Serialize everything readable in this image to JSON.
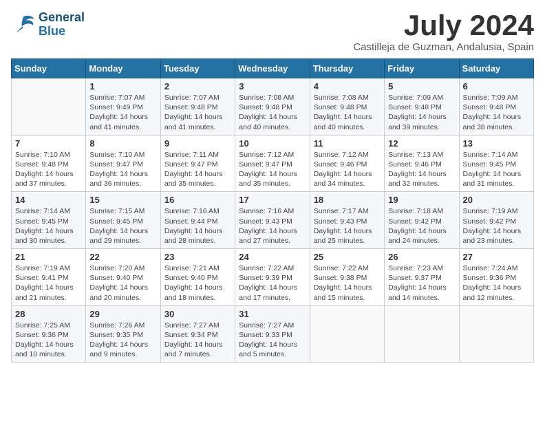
{
  "header": {
    "logo_line1": "General",
    "logo_line2": "Blue",
    "month_title": "July 2024",
    "location": "Castilleja de Guzman, Andalusia, Spain"
  },
  "weekdays": [
    "Sunday",
    "Monday",
    "Tuesday",
    "Wednesday",
    "Thursday",
    "Friday",
    "Saturday"
  ],
  "weeks": [
    [
      {
        "day": "",
        "info": ""
      },
      {
        "day": "1",
        "info": "Sunrise: 7:07 AM\nSunset: 9:49 PM\nDaylight: 14 hours\nand 41 minutes."
      },
      {
        "day": "2",
        "info": "Sunrise: 7:07 AM\nSunset: 9:48 PM\nDaylight: 14 hours\nand 41 minutes."
      },
      {
        "day": "3",
        "info": "Sunrise: 7:08 AM\nSunset: 9:48 PM\nDaylight: 14 hours\nand 40 minutes."
      },
      {
        "day": "4",
        "info": "Sunrise: 7:08 AM\nSunset: 9:48 PM\nDaylight: 14 hours\nand 40 minutes."
      },
      {
        "day": "5",
        "info": "Sunrise: 7:09 AM\nSunset: 9:48 PM\nDaylight: 14 hours\nand 39 minutes."
      },
      {
        "day": "6",
        "info": "Sunrise: 7:09 AM\nSunset: 9:48 PM\nDaylight: 14 hours\nand 38 minutes."
      }
    ],
    [
      {
        "day": "7",
        "info": "Sunrise: 7:10 AM\nSunset: 9:48 PM\nDaylight: 14 hours\nand 37 minutes."
      },
      {
        "day": "8",
        "info": "Sunrise: 7:10 AM\nSunset: 9:47 PM\nDaylight: 14 hours\nand 36 minutes."
      },
      {
        "day": "9",
        "info": "Sunrise: 7:11 AM\nSunset: 9:47 PM\nDaylight: 14 hours\nand 35 minutes."
      },
      {
        "day": "10",
        "info": "Sunrise: 7:12 AM\nSunset: 9:47 PM\nDaylight: 14 hours\nand 35 minutes."
      },
      {
        "day": "11",
        "info": "Sunrise: 7:12 AM\nSunset: 9:46 PM\nDaylight: 14 hours\nand 34 minutes."
      },
      {
        "day": "12",
        "info": "Sunrise: 7:13 AM\nSunset: 9:46 PM\nDaylight: 14 hours\nand 32 minutes."
      },
      {
        "day": "13",
        "info": "Sunrise: 7:14 AM\nSunset: 9:45 PM\nDaylight: 14 hours\nand 31 minutes."
      }
    ],
    [
      {
        "day": "14",
        "info": "Sunrise: 7:14 AM\nSunset: 9:45 PM\nDaylight: 14 hours\nand 30 minutes."
      },
      {
        "day": "15",
        "info": "Sunrise: 7:15 AM\nSunset: 9:45 PM\nDaylight: 14 hours\nand 29 minutes."
      },
      {
        "day": "16",
        "info": "Sunrise: 7:16 AM\nSunset: 9:44 PM\nDaylight: 14 hours\nand 28 minutes."
      },
      {
        "day": "17",
        "info": "Sunrise: 7:16 AM\nSunset: 9:43 PM\nDaylight: 14 hours\nand 27 minutes."
      },
      {
        "day": "18",
        "info": "Sunrise: 7:17 AM\nSunset: 9:43 PM\nDaylight: 14 hours\nand 25 minutes."
      },
      {
        "day": "19",
        "info": "Sunrise: 7:18 AM\nSunset: 9:42 PM\nDaylight: 14 hours\nand 24 minutes."
      },
      {
        "day": "20",
        "info": "Sunrise: 7:19 AM\nSunset: 9:42 PM\nDaylight: 14 hours\nand 23 minutes."
      }
    ],
    [
      {
        "day": "21",
        "info": "Sunrise: 7:19 AM\nSunset: 9:41 PM\nDaylight: 14 hours\nand 21 minutes."
      },
      {
        "day": "22",
        "info": "Sunrise: 7:20 AM\nSunset: 9:40 PM\nDaylight: 14 hours\nand 20 minutes."
      },
      {
        "day": "23",
        "info": "Sunrise: 7:21 AM\nSunset: 9:40 PM\nDaylight: 14 hours\nand 18 minutes."
      },
      {
        "day": "24",
        "info": "Sunrise: 7:22 AM\nSunset: 9:39 PM\nDaylight: 14 hours\nand 17 minutes."
      },
      {
        "day": "25",
        "info": "Sunrise: 7:22 AM\nSunset: 9:38 PM\nDaylight: 14 hours\nand 15 minutes."
      },
      {
        "day": "26",
        "info": "Sunrise: 7:23 AM\nSunset: 9:37 PM\nDaylight: 14 hours\nand 14 minutes."
      },
      {
        "day": "27",
        "info": "Sunrise: 7:24 AM\nSunset: 9:36 PM\nDaylight: 14 hours\nand 12 minutes."
      }
    ],
    [
      {
        "day": "28",
        "info": "Sunrise: 7:25 AM\nSunset: 9:36 PM\nDaylight: 14 hours\nand 10 minutes."
      },
      {
        "day": "29",
        "info": "Sunrise: 7:26 AM\nSunset: 9:35 PM\nDaylight: 14 hours\nand 9 minutes."
      },
      {
        "day": "30",
        "info": "Sunrise: 7:27 AM\nSunset: 9:34 PM\nDaylight: 14 hours\nand 7 minutes."
      },
      {
        "day": "31",
        "info": "Sunrise: 7:27 AM\nSunset: 9:33 PM\nDaylight: 14 hours\nand 5 minutes."
      },
      {
        "day": "",
        "info": ""
      },
      {
        "day": "",
        "info": ""
      },
      {
        "day": "",
        "info": ""
      }
    ]
  ]
}
